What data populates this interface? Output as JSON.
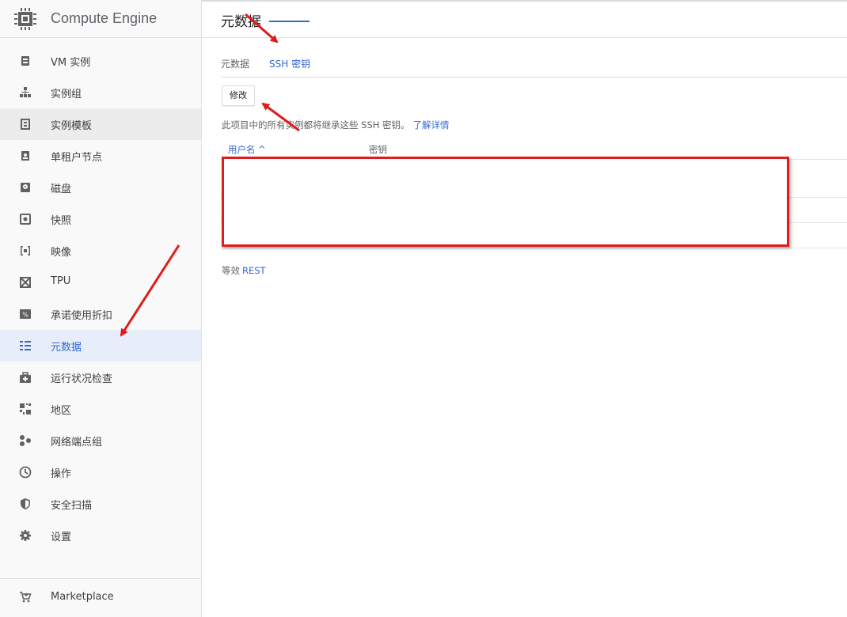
{
  "app": {
    "title": "Compute Engine",
    "icon": "chip-icon"
  },
  "sidebar": {
    "items": [
      {
        "label": "VM 实例",
        "icon": "vm-instance-icon"
      },
      {
        "label": "实例组",
        "icon": "instance-group-icon"
      },
      {
        "label": "实例模板",
        "icon": "instance-template-icon"
      },
      {
        "label": "单租户节点",
        "icon": "sole-tenant-icon"
      },
      {
        "label": "磁盘",
        "icon": "disk-icon"
      },
      {
        "label": "快照",
        "icon": "snapshot-icon"
      },
      {
        "label": "映像",
        "icon": "image-icon"
      },
      {
        "label": "TPU",
        "icon": "tpu-icon"
      },
      {
        "label": "承诺使用折扣",
        "icon": "discount-icon"
      },
      {
        "label": "元数据",
        "icon": "metadata-icon"
      },
      {
        "label": "运行状况检查",
        "icon": "health-check-icon"
      },
      {
        "label": "地区",
        "icon": "zones-icon"
      },
      {
        "label": "网络端点组",
        "icon": "network-endpoint-icon"
      },
      {
        "label": "操作",
        "icon": "operations-icon"
      },
      {
        "label": "安全扫描",
        "icon": "security-scan-icon"
      },
      {
        "label": "设置",
        "icon": "settings-icon"
      }
    ],
    "active_label": "元数据",
    "hover_label": "实例模板",
    "marketplace": {
      "label": "Marketplace",
      "icon": "cart-icon"
    }
  },
  "main": {
    "page_title": "元数据",
    "tabs": [
      {
        "label": "元数据"
      },
      {
        "label": "SSH 密钥"
      }
    ],
    "active_tab": "SSH 密钥",
    "edit_button": "修改",
    "description": "此项目中的所有实例都将继承这些 SSH 密钥。",
    "learn_more": "了解详情",
    "table": {
      "columns": [
        {
          "label": "用户名 ^"
        },
        {
          "label": "密钥"
        }
      ],
      "rows": []
    },
    "equivalent_label": "等效",
    "equivalent_link": "REST"
  },
  "colors": {
    "accent": "#3367d6",
    "annotation": "#e01b1b",
    "sidebar_bg": "#f9f9f9",
    "active_bg": "#e8eef9"
  }
}
